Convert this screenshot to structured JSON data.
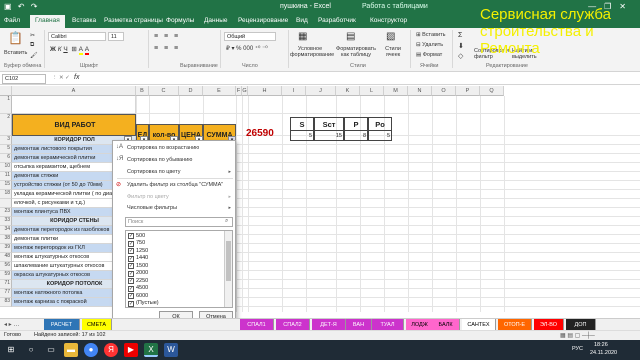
{
  "window": {
    "title": "пушкина - Excel",
    "context_tab": "Работа с таблицами",
    "window_controls": [
      "minimize-icon",
      "restore-icon",
      "close-icon"
    ]
  },
  "ribbon_tabs": [
    "Файл",
    "Главная",
    "Вставка",
    "Разметка страницы",
    "Формулы",
    "Данные",
    "Рецензирование",
    "Вид",
    "Разработчик",
    "Конструктор"
  ],
  "ribbon": {
    "paste": "Вставить",
    "font_name": "Calibri",
    "font_size": "11",
    "number_format": "Общий",
    "cond_format": "Условное форматирование",
    "format_table": "Форматировать как таблицу",
    "cell_styles": "Стили ячеек",
    "insert": "Вставить",
    "delete": "Удалить",
    "format": "Формат",
    "sort_filter": "Сортировка и фильтр",
    "find_select": "Найти и выделить",
    "groups": [
      "Буфер обмена",
      "Шрифт",
      "Выравнивание",
      "Число",
      "Стили",
      "Ячейки",
      "Редактирование"
    ]
  },
  "overlay_text": "Сервисная служба строительства и Ремонта",
  "formula_bar": {
    "name_box": "C102",
    "fx": "fx",
    "value": ""
  },
  "columns": [
    "A",
    "B",
    "C",
    "D",
    "E",
    "F",
    "G",
    "H",
    "I",
    "J",
    "K",
    "L",
    "M",
    "N",
    "O",
    "P",
    "Q"
  ],
  "rows": [
    {
      "num": "1",
      "text": "",
      "style": "plain"
    },
    {
      "num": "2",
      "text": "ВИД РАБОТ",
      "style": "header"
    },
    {
      "num": "3",
      "text": "КОРИДОР ПОЛ",
      "style": "section"
    },
    {
      "num": "5",
      "text": "демонтаж листового покрытия",
      "style": "blue"
    },
    {
      "num": "6",
      "text": "демонтаж керамической плитки",
      "style": "blue"
    },
    {
      "num": "10",
      "text": "отсыпка керамзитом, щебнем",
      "style": "plain"
    },
    {
      "num": "11",
      "text": "демонтаж стяжки",
      "style": "blue"
    },
    {
      "num": "15",
      "text": "устройство стяжки (от 50 до 70мм)",
      "style": "blue"
    },
    {
      "num": "18",
      "text": "укладка керамической плитки ( по диаг",
      "style": "plain"
    },
    {
      "num": "",
      "text": "елочкой, с рисунками и т.д.)",
      "style": "plain"
    },
    {
      "num": "23",
      "text": "монтаж плинтуса ПВХ",
      "style": "blue"
    },
    {
      "num": "33",
      "text": "КОРИДОР СТЕНЫ",
      "style": "section"
    },
    {
      "num": "34",
      "text": "демонтаж перегородок из газоблоков",
      "style": "blue"
    },
    {
      "num": "38",
      "text": "демонтаж плитки",
      "style": "plain"
    },
    {
      "num": "39",
      "text": "монтаж перегородок из ГКЛ",
      "style": "blue"
    },
    {
      "num": "48",
      "text": "монтаж штукатурных откосов",
      "style": "plain"
    },
    {
      "num": "56",
      "text": "шпаклевание штукатурных откосов",
      "style": "plain"
    },
    {
      "num": "59",
      "text": "окраска штукатурных откосов",
      "style": "blue"
    },
    {
      "num": "71",
      "text": "КОРИДОР ПОТОЛОК",
      "style": "section"
    },
    {
      "num": "77",
      "text": "монтаж натяжного потолка",
      "style": "blue"
    },
    {
      "num": "83",
      "text": "монтаж карниза с покраской",
      "style": "blue"
    }
  ],
  "table_header": {
    "b": "ЕД",
    "c": "кол-во",
    "d": "ЦЕНА",
    "e": "СУММА"
  },
  "total": "26590",
  "summary": {
    "headers": [
      "S",
      "Sст",
      "P",
      "Po"
    ],
    "values": [
      "5",
      "15",
      "8",
      "5"
    ]
  },
  "filter_menu": {
    "items": [
      {
        "label": "Сортировка по возрастанию",
        "icon": "sort-asc-icon",
        "disabled": false,
        "submenu": false
      },
      {
        "label": "Сортировка по убыванию",
        "icon": "sort-desc-icon",
        "disabled": false,
        "submenu": false
      },
      {
        "label": "Сортировка по цвету",
        "icon": "",
        "disabled": false,
        "submenu": true
      },
      {
        "label": "Удалить фильтр из столбца \"СУММА\"",
        "icon": "clear-filter-icon",
        "disabled": false,
        "submenu": false
      },
      {
        "label": "Фильтр по цвету",
        "icon": "",
        "disabled": true,
        "submenu": true
      },
      {
        "label": "Числовые фильтры",
        "icon": "",
        "disabled": false,
        "submenu": true
      }
    ],
    "search_placeholder": "Поиск",
    "values": [
      "500",
      "750",
      "1250",
      "1440",
      "1500",
      "2000",
      "2250",
      "4500",
      "6000",
      "(Пустые)"
    ],
    "ok": "ОК",
    "cancel": "Отмена"
  },
  "sheet_tabs": [
    {
      "label": "РАСЧЕТ",
      "color": "#2e75b6",
      "text": "#ffffff"
    },
    {
      "label": "СМЕТА",
      "color": "#ffff00",
      "text": "#000000"
    },
    {
      "label": "СПАЛ1",
      "color": "#cc33cc",
      "text": "#ffffff"
    },
    {
      "label": "СПАЛ2",
      "color": "#cc33cc",
      "text": "#ffffff"
    },
    {
      "label": "ДЕТ-Я",
      "color": "#cc33cc",
      "text": "#ffffff"
    },
    {
      "label": "ВАН",
      "color": "#cc33cc",
      "text": "#ffffff"
    },
    {
      "label": "ТУАЛ",
      "color": "#cc33cc",
      "text": "#ffffff"
    },
    {
      "label": "ЛОДЖ",
      "color": "#ff66cc",
      "text": "#000000"
    },
    {
      "label": "БАЛК",
      "color": "#ff66cc",
      "text": "#000000"
    },
    {
      "label": "САНТЕХ",
      "color": "#ffffff",
      "text": "#000000"
    },
    {
      "label": "ОТОП-Е",
      "color": "#ff6600",
      "text": "#ffffff"
    },
    {
      "label": "ЭЛ-ВО",
      "color": "#ff0000",
      "text": "#ffffff"
    },
    {
      "label": "ДОП",
      "color": "#222222",
      "text": "#ffffff"
    }
  ],
  "status": {
    "ready": "Готово",
    "found": "Найдено записей: 17 из 102"
  },
  "taskbar": {
    "time": "18:26",
    "date": "24.11.2020",
    "lang": "РУС",
    "apps": [
      "windows-start-icon",
      "search-icon",
      "task-view-icon",
      "explorer-icon",
      "chrome-icon",
      "yandex-icon",
      "youtube-icon",
      "excel-icon",
      "word-icon"
    ]
  },
  "colors": {
    "excel_green": "#217346",
    "header_orange": "#f4b01f",
    "row_blue": "#c6d9f1",
    "total_red": "#c00000"
  }
}
